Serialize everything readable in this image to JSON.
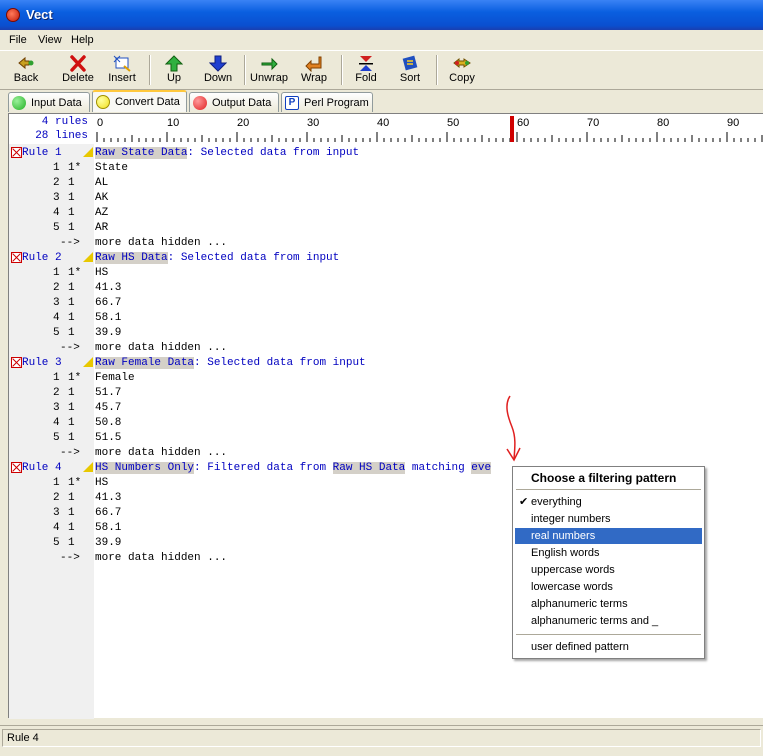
{
  "window": {
    "title": "Vect"
  },
  "menu": [
    "File",
    "View",
    "Help"
  ],
  "toolbar": [
    {
      "label": "Back",
      "icon": "back-icon"
    },
    {
      "label": "Delete",
      "icon": "delete-icon"
    },
    {
      "label": "Insert",
      "icon": "insert-icon"
    },
    {
      "label": "Up",
      "icon": "up-arrow-icon"
    },
    {
      "label": "Down",
      "icon": "down-arrow-icon"
    },
    {
      "label": "Unwrap",
      "icon": "unwrap-icon"
    },
    {
      "label": "Wrap",
      "icon": "wrap-icon"
    },
    {
      "label": "Fold",
      "icon": "fold-icon"
    },
    {
      "label": "Sort",
      "icon": "sort-icon"
    },
    {
      "label": "Copy",
      "icon": "copy-icon"
    }
  ],
  "tabs": [
    {
      "label": "Input Data",
      "color": "#22b022",
      "active": false
    },
    {
      "label": "Convert Data",
      "color": "#f0e020",
      "active": true
    },
    {
      "label": "Output Data",
      "color": "#e02020",
      "active": false
    },
    {
      "label": "Perl Program",
      "color": "#1040c0",
      "active": false
    }
  ],
  "ruler": {
    "rules_count": "4 rules",
    "lines_count": "28 lines",
    "ticks": [
      "0",
      "10",
      "20",
      "30",
      "40",
      "50",
      "60",
      "70",
      "80",
      "90"
    ],
    "marker_color": "#d00000"
  },
  "rules": [
    {
      "label": "Rule 1",
      "name": "Raw State Data",
      "desc": ": Selected data from input",
      "rows": [
        {
          "num": "1",
          "src": "1*",
          "val": "State"
        },
        {
          "num": "2",
          "src": "1",
          "val": "AL"
        },
        {
          "num": "3",
          "src": "1",
          "val": "AK"
        },
        {
          "num": "4",
          "src": "1",
          "val": "AZ"
        },
        {
          "num": "5",
          "src": "1",
          "val": "AR"
        }
      ]
    },
    {
      "label": "Rule 2",
      "name": "Raw HS Data",
      "desc": ": Selected data from input",
      "rows": [
        {
          "num": "1",
          "src": "1*",
          "val": "HS"
        },
        {
          "num": "2",
          "src": "1",
          "val": "41.3"
        },
        {
          "num": "3",
          "src": "1",
          "val": "66.7"
        },
        {
          "num": "4",
          "src": "1",
          "val": "58.1"
        },
        {
          "num": "5",
          "src": "1",
          "val": "39.9"
        }
      ]
    },
    {
      "label": "Rule 3",
      "name": "Raw Female Data",
      "desc": ": Selected data from input",
      "rows": [
        {
          "num": "1",
          "src": "1*",
          "val": "Female"
        },
        {
          "num": "2",
          "src": "1",
          "val": "51.7"
        },
        {
          "num": "3",
          "src": "1",
          "val": "45.7"
        },
        {
          "num": "4",
          "src": "1",
          "val": "50.8"
        },
        {
          "num": "5",
          "src": "1",
          "val": "51.5"
        }
      ]
    },
    {
      "label": "Rule 4",
      "name": "HS Numbers Only",
      "desc": ": Filtered data from ",
      "ref": "Raw HS Data",
      "mid": " matching ",
      "pattern": "eve",
      "rows": [
        {
          "num": "1",
          "src": "1*",
          "val": "HS"
        },
        {
          "num": "2",
          "src": "1",
          "val": "41.3"
        },
        {
          "num": "3",
          "src": "1",
          "val": "66.7"
        },
        {
          "num": "4",
          "src": "1",
          "val": "58.1"
        },
        {
          "num": "5",
          "src": "1",
          "val": "39.9"
        }
      ]
    }
  ],
  "more_arrow": "-->",
  "more_text": "more data hidden ...",
  "context_menu": {
    "title": "Choose a filtering pattern",
    "items": [
      {
        "label": "everything",
        "checked": true
      },
      {
        "label": "integer numbers"
      },
      {
        "label": "real numbers",
        "selected": true
      },
      {
        "label": "English words"
      },
      {
        "label": "uppercase words"
      },
      {
        "label": "lowercase words"
      },
      {
        "label": "alphanumeric terms"
      },
      {
        "label": "alphanumeric terms and _"
      }
    ],
    "extra_item": "user defined pattern",
    "check_glyph": "✔"
  },
  "status": {
    "text": "Rule 4"
  }
}
